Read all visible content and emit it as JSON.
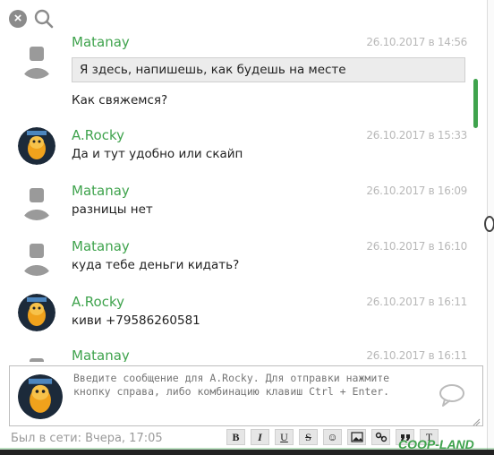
{
  "colors": {
    "accent": "#3fa34d",
    "time": "#b8b8b8",
    "status": "#9a9a9a"
  },
  "messages": [
    {
      "author": "Matanay",
      "time": "26.10.2017 в 14:56",
      "quote": "Я здесь, напишешь, как будешь на месте",
      "text": "Как свяжемся?",
      "avatar": "default-avatar"
    },
    {
      "author": "A.Rocky",
      "time": "26.10.2017 в 15:33",
      "text": "Да и тут удобно или скайп",
      "avatar": "tiger-avatar"
    },
    {
      "author": "Matanay",
      "time": "26.10.2017 в 16:09",
      "text": "разницы нет",
      "avatar": "default-avatar"
    },
    {
      "author": "Matanay",
      "time": "26.10.2017 в 16:10",
      "text": "куда тебе деньги кидать?",
      "avatar": "default-avatar"
    },
    {
      "author": "A.Rocky",
      "time": "26.10.2017 в 16:11",
      "text": "киви +79586260581",
      "avatar": "tiger-avatar"
    },
    {
      "author": "Matanay",
      "time": "26.10.2017 в 16:11",
      "text": "",
      "avatar": "default-avatar"
    }
  ],
  "composer": {
    "placeholder": "Введите сообщение для A.Rocky. Для отправки нажмите кнопку справа, либо комбинацию клавиш Ctrl + Enter.",
    "avatar": "tiger-avatar"
  },
  "status": "Был в сети: Вчера, 17:05",
  "toolbar": {
    "bold": "B",
    "italic": "I",
    "underline": "U",
    "strike": "S",
    "smile": "☺",
    "image": "image-icon",
    "link": "link-icon",
    "quote": "quote-icon",
    "format": "T"
  },
  "watermark": "COOP-LAND"
}
